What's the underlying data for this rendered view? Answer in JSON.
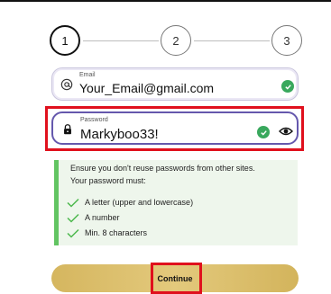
{
  "stepper": {
    "steps": [
      "1",
      "2",
      "3"
    ],
    "current": 1
  },
  "email": {
    "label": "Email",
    "value": "Your_Email@gmail.com"
  },
  "password": {
    "label": "Password",
    "value": "Markyboo33!"
  },
  "info": {
    "line1": "Ensure you don't reuse passwords from other sites.",
    "line2": "Your password must:",
    "requirements": [
      "A letter (upper and lowercase)",
      "A number",
      "Min. 8 characters"
    ]
  },
  "button": {
    "label": "Continue"
  },
  "colors": {
    "accent": "#6558ad",
    "success": "#39a85d",
    "highlight": "#e0101d",
    "button": "#ddc171"
  },
  "icons": {
    "email": "at-sign-icon",
    "password": "lock-icon",
    "valid": "check-circle-icon",
    "reveal": "eye-icon",
    "requirement": "checkmark-icon"
  }
}
